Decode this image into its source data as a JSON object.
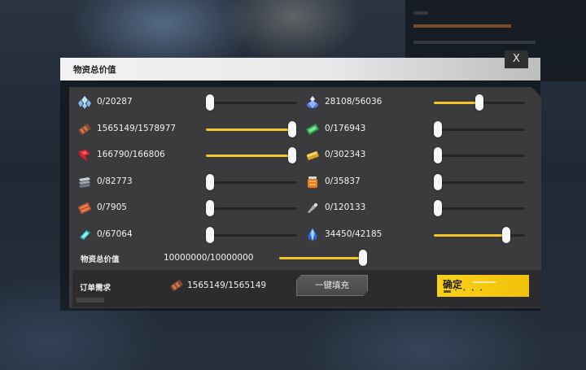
{
  "dialog": {
    "title": "物资总价值",
    "close_label": "X"
  },
  "resources": [
    {
      "icon": "blue-crystal-cluster-icon",
      "value": "0/20287",
      "fill": 0
    },
    {
      "icon": "purple-blue-crystal-icon",
      "value": "28108/56036",
      "fill": 0.5
    },
    {
      "icon": "brown-material-icon",
      "value": "1565149/1578977",
      "fill": 0.99
    },
    {
      "icon": "green-chip-icon",
      "value": "0/176943",
      "fill": 0
    },
    {
      "icon": "red-arrow-material-icon",
      "value": "166790/166806",
      "fill": 0.99
    },
    {
      "icon": "gold-bar-icon",
      "value": "0/302343",
      "fill": 0
    },
    {
      "icon": "metal-plates-icon",
      "value": "0/82773",
      "fill": 0
    },
    {
      "icon": "orange-canister-icon",
      "value": "0/35837",
      "fill": 0
    },
    {
      "icon": "red-brick-material-icon",
      "value": "0/7905",
      "fill": 0
    },
    {
      "icon": "gray-tool-icon",
      "value": "0/120133",
      "fill": 0
    },
    {
      "icon": "cyan-shard-icon",
      "value": "0/67064",
      "fill": 0
    },
    {
      "icon": "blue-crystal-icon",
      "value": "34450/42185",
      "fill": 0.82
    }
  ],
  "total": {
    "label": "物资总价值",
    "value": "10000000/10000000",
    "fill": 1.0
  },
  "order": {
    "label": "订单需求",
    "icon": "brown-material-icon",
    "value": "1565149/1565149"
  },
  "buttons": {
    "auto_fill": "一键填充",
    "confirm": "确定"
  },
  "colors": {
    "accent": "#f2c32c",
    "confirm": "#f9d21c",
    "panel": "#3b3b3d"
  }
}
